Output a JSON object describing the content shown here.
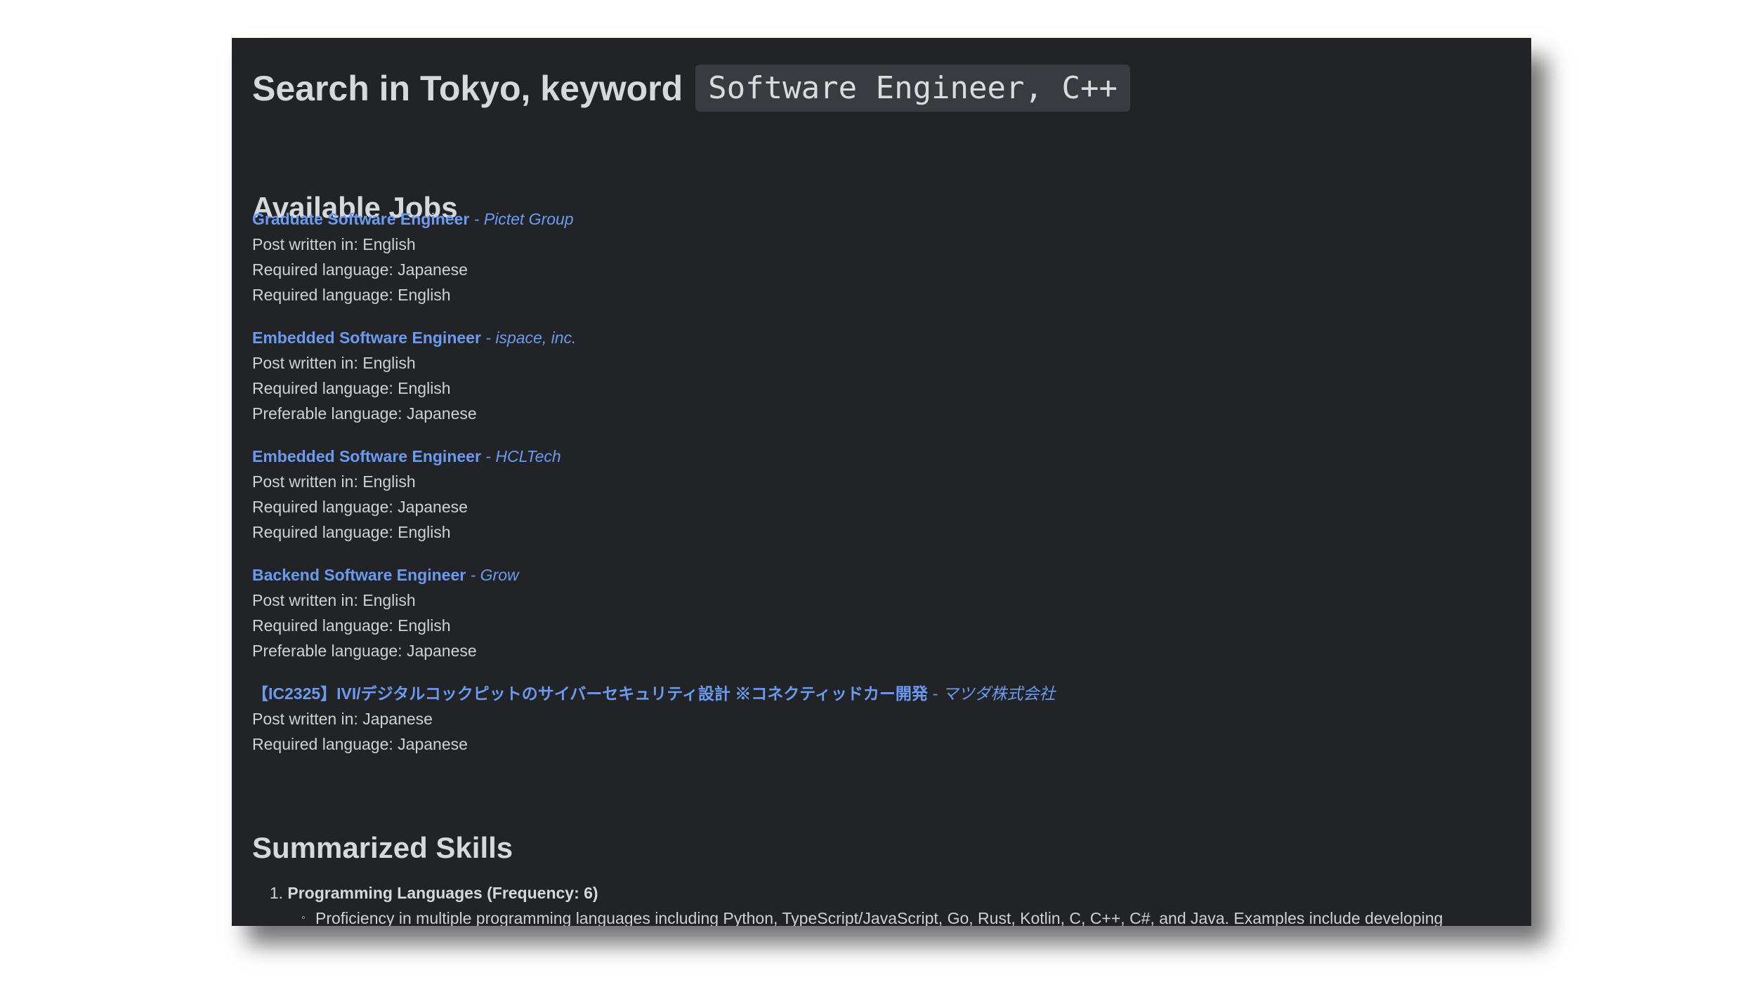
{
  "search": {
    "title": "Search in Tokyo, keyword",
    "keyword": "Software Engineer, C++"
  },
  "jobs_section": {
    "heading": "Available Jobs",
    "jobs": [
      {
        "title": "Graduate Software Engineer",
        "separator": " - ",
        "company": "Pictet Group",
        "lines": [
          "Post written in: English",
          "Required language: Japanese",
          "Required language: English"
        ]
      },
      {
        "title": "Embedded Software Engineer",
        "separator": " - ",
        "company": "ispace, inc.",
        "lines": [
          "Post written in: English",
          "Required language: English",
          "Preferable language: Japanese"
        ]
      },
      {
        "title": "Embedded Software Engineer",
        "separator": " - ",
        "company": "HCLTech",
        "lines": [
          "Post written in: English",
          "Required language: Japanese",
          "Required language: English"
        ]
      },
      {
        "title": "Backend Software Engineer",
        "separator": " - ",
        "company": "Grow",
        "lines": [
          "Post written in: English",
          "Required language: English",
          "Preferable language: Japanese"
        ]
      },
      {
        "title": "【IC2325】IVI/デジタルコックピットのサイバーセキュリティ設計 ※コネクティッドカー開発",
        "separator": " - ",
        "company": "マツダ株式会社",
        "lines": [
          "Post written in: Japanese",
          "Required language: Japanese"
        ]
      }
    ]
  },
  "skills_section": {
    "heading": "Summarized Skills",
    "items": [
      {
        "number": "1.",
        "name": "Programming Languages (Frequency: 6)",
        "bullet": "◦",
        "description": "Proficiency in multiple programming languages including Python, TypeScript/JavaScript, Go, Rust, Kotlin, C, C++, C#, and Java. Examples include developing software, APIs, backend services, embedded systems, and security features across diverse platforms. Openness to learning new languages and frameworks demonstrates"
      }
    ]
  }
}
